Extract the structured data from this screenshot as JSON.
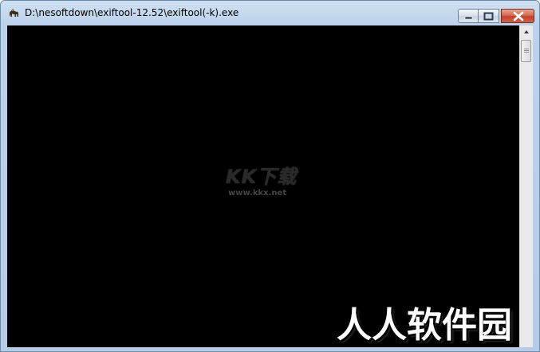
{
  "window": {
    "title": "D:\\nesoftdown\\exiftool-12.52\\exiftool(-k).exe",
    "icon": "camel-icon",
    "buttons": {
      "minimize": "minimize-icon",
      "maximize": "maximize-icon",
      "close": "close-icon"
    }
  },
  "console": {
    "background": "#000000",
    "content": ""
  },
  "scrollbar": {
    "up_arrow": "chevron-up-icon"
  },
  "watermarks": {
    "logo_text": "KK下载",
    "url_text": "www.kkx.net",
    "site_text": "人人软件园"
  },
  "colors": {
    "close_button": "#c2412b",
    "titlebar": "#bcd2ea"
  }
}
